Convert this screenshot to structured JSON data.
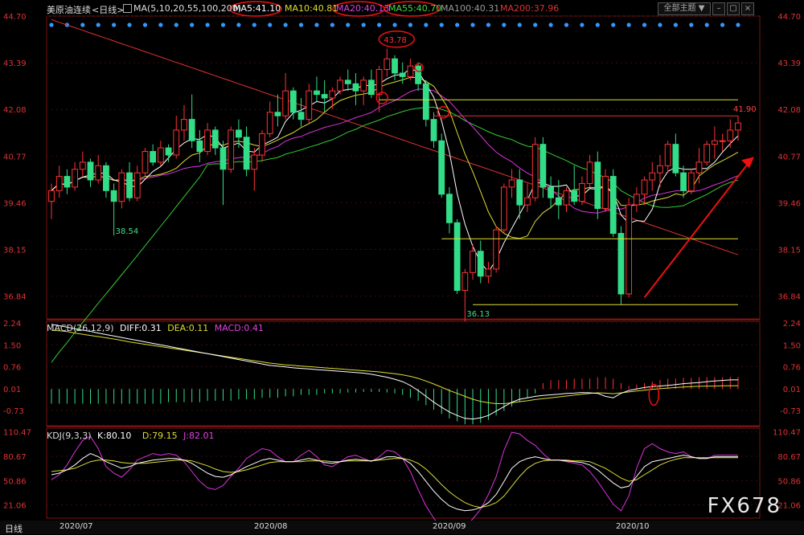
{
  "header": {
    "symbol": "美原油连续",
    "period": "<日线>",
    "ma_label": "MA(5,10,20,55,100,200)",
    "ma5": "MA5:41.10",
    "ma10": "MA10:40.81",
    "ma20": "MA20:40.13",
    "ma55": "MA55:40.70",
    "ma100": "MA100:40.31",
    "ma200": "MA200:37.96",
    "theme_button": "全部主题",
    "theme_arrow": "▼"
  },
  "macd": {
    "label": "MACD(26,12,9)",
    "diff": "DIFF:0.31",
    "dea": "DEA:0.11",
    "macd": "MACD:0.41"
  },
  "kdj": {
    "label": "KDJ(9,3,3)",
    "k": "K:80.10",
    "d": "D:79.15",
    "j": "J:82.01"
  },
  "footer": {
    "period": "日线",
    "dates": [
      "2020/07",
      "2020/08",
      "2020/09",
      "2020/10"
    ]
  },
  "watermark": "FX678",
  "colors": {
    "up": "#ff3333",
    "down": "#33dd88",
    "ma5": "#ffffff",
    "ma10": "#dddd33",
    "ma20": "#dd33dd",
    "ma55": "#33cc33",
    "ma100": "#999999",
    "ma200": "#dd3333",
    "dot": "#3399ff"
  },
  "chart_data": [
    {
      "type": "candlestick",
      "panel": "price",
      "ylim": [
        36.2,
        44.7
      ],
      "y_ticks": [
        "44.70",
        "43.39",
        "42.08",
        "40.77",
        "39.46",
        "38.15",
        "36.84"
      ],
      "annotations": [
        "43.78",
        "41.90",
        "38.54",
        "36.13"
      ],
      "candles": [
        [
          39.5,
          40.0,
          39.0,
          39.8
        ],
        [
          39.8,
          40.5,
          39.6,
          40.2
        ],
        [
          40.2,
          40.4,
          39.7,
          39.9
        ],
        [
          39.9,
          40.6,
          39.8,
          40.4
        ],
        [
          40.4,
          40.9,
          40.2,
          40.6
        ],
        [
          40.6,
          40.7,
          39.9,
          40.1
        ],
        [
          40.1,
          40.8,
          40.0,
          40.5
        ],
        [
          40.5,
          40.6,
          39.6,
          39.8
        ],
        [
          39.8,
          40.0,
          38.54,
          39.5
        ],
        [
          39.5,
          40.4,
          39.3,
          40.3
        ],
        [
          40.3,
          40.6,
          39.5,
          39.6
        ],
        [
          39.6,
          40.5,
          39.5,
          40.3
        ],
        [
          40.3,
          41.0,
          40.2,
          40.9
        ],
        [
          40.9,
          41.1,
          40.5,
          40.6
        ],
        [
          40.6,
          41.2,
          40.5,
          41.0
        ],
        [
          41.0,
          41.1,
          40.6,
          40.8
        ],
        [
          40.8,
          41.9,
          40.7,
          41.5
        ],
        [
          41.5,
          42.2,
          41.2,
          41.8
        ],
        [
          41.8,
          42.5,
          41.0,
          41.2
        ],
        [
          41.2,
          41.5,
          40.6,
          40.9
        ],
        [
          40.9,
          41.7,
          40.8,
          41.5
        ],
        [
          41.5,
          41.6,
          40.8,
          41.0
        ],
        [
          41.0,
          41.2,
          39.4,
          40.4
        ],
        [
          40.4,
          41.6,
          40.3,
          41.5
        ],
        [
          41.5,
          41.8,
          41.0,
          41.3
        ],
        [
          41.3,
          41.6,
          40.2,
          40.4
        ],
        [
          40.4,
          41.0,
          39.8,
          40.8
        ],
        [
          40.8,
          41.5,
          40.6,
          41.4
        ],
        [
          41.4,
          42.3,
          41.3,
          42.0
        ],
        [
          42.0,
          42.5,
          41.6,
          41.9
        ],
        [
          41.9,
          43.1,
          41.8,
          42.6
        ],
        [
          42.6,
          42.7,
          41.8,
          42.0
        ],
        [
          42.0,
          42.4,
          41.6,
          41.8
        ],
        [
          41.8,
          42.8,
          41.7,
          42.6
        ],
        [
          42.6,
          43.0,
          42.3,
          42.5
        ],
        [
          42.5,
          42.9,
          42.0,
          42.4
        ],
        [
          42.4,
          42.7,
          42.1,
          42.6
        ],
        [
          42.6,
          43.0,
          42.5,
          42.9
        ],
        [
          42.9,
          43.2,
          42.6,
          42.8
        ],
        [
          42.8,
          43.1,
          42.2,
          42.6
        ],
        [
          42.6,
          43.0,
          42.2,
          42.9
        ],
        [
          42.9,
          43.2,
          42.4,
          42.5
        ],
        [
          42.5,
          43.3,
          42.0,
          43.2
        ],
        [
          43.2,
          43.78,
          43.0,
          43.5
        ],
        [
          43.5,
          43.6,
          42.9,
          43.1
        ],
        [
          43.1,
          43.4,
          42.8,
          43.0
        ],
        [
          43.0,
          43.5,
          42.9,
          43.3
        ],
        [
          43.3,
          43.4,
          42.6,
          42.8
        ],
        [
          42.8,
          42.9,
          41.6,
          41.8
        ],
        [
          41.8,
          42.0,
          41.0,
          41.2
        ],
        [
          41.2,
          41.4,
          39.6,
          39.7
        ],
        [
          39.7,
          39.9,
          38.6,
          38.9
        ],
        [
          38.9,
          39.0,
          36.9,
          37.0
        ],
        [
          37.0,
          37.6,
          36.13,
          37.5
        ],
        [
          37.5,
          38.3,
          37.3,
          38.1
        ],
        [
          38.1,
          38.4,
          37.2,
          37.4
        ],
        [
          37.4,
          37.8,
          37.2,
          37.6
        ],
        [
          37.6,
          38.8,
          37.5,
          38.7
        ],
        [
          38.7,
          40.0,
          38.6,
          39.9
        ],
        [
          39.9,
          40.4,
          39.6,
          40.1
        ],
        [
          40.1,
          40.4,
          39.0,
          39.4
        ],
        [
          39.4,
          40.0,
          39.2,
          39.6
        ],
        [
          39.6,
          41.3,
          39.5,
          41.1
        ],
        [
          41.1,
          41.3,
          39.6,
          39.9
        ],
        [
          39.9,
          40.2,
          39.3,
          39.6
        ],
        [
          39.6,
          40.1,
          39.0,
          39.4
        ],
        [
          39.4,
          39.9,
          39.2,
          39.8
        ],
        [
          39.8,
          40.5,
          39.4,
          39.5
        ],
        [
          39.5,
          40.2,
          39.4,
          40.0
        ],
        [
          40.0,
          40.8,
          39.9,
          40.6
        ],
        [
          40.6,
          40.9,
          39.0,
          39.3
        ],
        [
          39.3,
          40.4,
          39.2,
          40.2
        ],
        [
          40.2,
          40.4,
          38.5,
          38.6
        ],
        [
          38.6,
          38.8,
          36.6,
          36.9
        ],
        [
          36.9,
          39.6,
          36.8,
          39.4
        ],
        [
          39.4,
          39.9,
          39.2,
          39.7
        ],
        [
          39.7,
          40.2,
          39.4,
          40.1
        ],
        [
          40.1,
          40.6,
          39.8,
          40.3
        ],
        [
          40.3,
          40.8,
          39.9,
          40.5
        ],
        [
          40.5,
          41.2,
          40.3,
          41.1
        ],
        [
          41.1,
          41.4,
          40.2,
          40.3
        ],
        [
          40.3,
          40.5,
          39.6,
          39.8
        ],
        [
          39.8,
          40.4,
          39.7,
          40.3
        ],
        [
          40.3,
          41.0,
          40.0,
          40.6
        ],
        [
          40.6,
          41.2,
          40.5,
          41.1
        ],
        [
          41.1,
          41.6,
          40.7,
          41.2
        ],
        [
          41.2,
          41.4,
          40.9,
          41.2
        ],
        [
          41.2,
          41.8,
          41.0,
          41.5
        ],
        [
          41.5,
          41.9,
          41.2,
          41.7
        ]
      ]
    },
    {
      "type": "macd",
      "panel": "macd",
      "ylim": [
        -1.25,
        2.3
      ],
      "y_ticks": [
        "2.24",
        "1.50",
        "0.76",
        "0.01",
        "-0.73"
      ],
      "diff": [
        2.2,
        2.15,
        2.1,
        2.05,
        2.0,
        1.96,
        1.9,
        1.85,
        1.8,
        1.75,
        1.7,
        1.65,
        1.6,
        1.55,
        1.5,
        1.45,
        1.4,
        1.35,
        1.3,
        1.25,
        1.2,
        1.15,
        1.1,
        1.05,
        1.0,
        0.95,
        0.9,
        0.85,
        0.8,
        0.78,
        0.75,
        0.72,
        0.7,
        0.68,
        0.66,
        0.64,
        0.62,
        0.6,
        0.58,
        0.56,
        0.54,
        0.5,
        0.45,
        0.4,
        0.33,
        0.25,
        0.12,
        -0.05,
        -0.25,
        -0.45,
        -0.62,
        -0.78,
        -0.9,
        -1.0,
        -1.02,
        -0.98,
        -0.9,
        -0.75,
        -0.6,
        -0.45,
        -0.35,
        -0.3,
        -0.25,
        -0.22,
        -0.2,
        -0.18,
        -0.15,
        -0.14,
        -0.12,
        -0.13,
        -0.15,
        -0.25,
        -0.3,
        -0.15,
        -0.05,
        0.0,
        0.05,
        0.08,
        0.1,
        0.12,
        0.15,
        0.18,
        0.2,
        0.22,
        0.25,
        0.27,
        0.29,
        0.31,
        0.31
      ],
      "dea": [
        2.0,
        1.98,
        1.95,
        1.9,
        1.86,
        1.82,
        1.78,
        1.74,
        1.7,
        1.65,
        1.6,
        1.56,
        1.52,
        1.48,
        1.44,
        1.4,
        1.36,
        1.32,
        1.28,
        1.24,
        1.2,
        1.16,
        1.12,
        1.08,
        1.04,
        1.0,
        0.96,
        0.92,
        0.88,
        0.85,
        0.82,
        0.8,
        0.78,
        0.76,
        0.74,
        0.72,
        0.7,
        0.68,
        0.66,
        0.64,
        0.62,
        0.6,
        0.58,
        0.55,
        0.52,
        0.48,
        0.43,
        0.36,
        0.27,
        0.17,
        0.06,
        -0.05,
        -0.15,
        -0.25,
        -0.35,
        -0.42,
        -0.47,
        -0.5,
        -0.5,
        -0.47,
        -0.43,
        -0.4,
        -0.36,
        -0.33,
        -0.3,
        -0.27,
        -0.24,
        -0.21,
        -0.18,
        -0.15,
        -0.13,
        -0.14,
        -0.16,
        -0.13,
        -0.1,
        -0.07,
        -0.04,
        -0.01,
        0.01,
        0.03,
        0.05,
        0.07,
        0.08,
        0.09,
        0.1,
        0.1,
        0.11,
        0.11,
        0.11
      ],
      "hist": [
        -0.5,
        -0.5,
        -0.5,
        -0.5,
        -0.5,
        -0.5,
        -0.5,
        -0.5,
        -0.5,
        -0.5,
        -0.5,
        -0.5,
        -0.5,
        -0.5,
        -0.5,
        -0.45,
        -0.45,
        -0.45,
        -0.45,
        -0.45,
        -0.4,
        -0.4,
        -0.4,
        -0.4,
        -0.35,
        -0.35,
        -0.35,
        -0.3,
        -0.3,
        -0.3,
        -0.25,
        -0.25,
        -0.2,
        -0.2,
        -0.2,
        -0.15,
        -0.15,
        -0.15,
        -0.12,
        -0.12,
        -0.1,
        -0.1,
        -0.1,
        -0.12,
        -0.15,
        -0.2,
        -0.3,
        -0.4,
        -0.55,
        -0.7,
        -0.85,
        -1.0,
        -1.1,
        -1.2,
        -1.2,
        -1.15,
        -1.05,
        -0.9,
        -0.75,
        -0.6,
        -0.45,
        -0.3,
        -0.15,
        0.2,
        0.3,
        0.3,
        0.3,
        0.35,
        0.35,
        0.35,
        0.4,
        0.4,
        0.35,
        0.2,
        0.1,
        0.15,
        0.2,
        0.25,
        0.3,
        0.35,
        0.35,
        0.38,
        0.38,
        0.4,
        0.4,
        0.4,
        0.4,
        0.41,
        0.41
      ]
    },
    {
      "type": "kdj",
      "panel": "kdj",
      "ylim": [
        5,
        115
      ],
      "y_ticks": [
        "110.47",
        "80.67",
        "50.86",
        "21.06"
      ],
      "k": [
        58,
        60,
        64,
        70,
        78,
        84,
        80,
        74,
        70,
        66,
        68,
        72,
        74,
        76,
        77,
        78,
        78,
        76,
        72,
        66,
        60,
        56,
        55,
        58,
        63,
        68,
        72,
        76,
        78,
        76,
        74,
        74,
        76,
        78,
        76,
        73,
        72,
        74,
        76,
        77,
        76,
        75,
        77,
        80,
        80,
        78,
        72,
        62,
        50,
        38,
        28,
        20,
        16,
        14,
        15,
        18,
        24,
        34,
        50,
        66,
        74,
        78,
        80,
        78,
        76,
        76,
        75,
        74,
        73,
        70,
        64,
        56,
        48,
        42,
        44,
        56,
        68,
        74,
        76,
        78,
        80,
        82,
        80,
        78,
        78,
        80,
        80,
        80,
        80
      ],
      "d": [
        62,
        63,
        64,
        66,
        70,
        74,
        76,
        76,
        75,
        73,
        72,
        72,
        72,
        73,
        74,
        75,
        76,
        76,
        75,
        72,
        69,
        65,
        62,
        61,
        62,
        64,
        67,
        70,
        73,
        74,
        74,
        74,
        74,
        75,
        75,
        75,
        74,
        74,
        75,
        75,
        75,
        75,
        76,
        77,
        78,
        78,
        76,
        72,
        65,
        56,
        46,
        37,
        30,
        24,
        20,
        18,
        20,
        24,
        32,
        44,
        56,
        66,
        72,
        75,
        76,
        76,
        76,
        75,
        75,
        74,
        70,
        66,
        60,
        54,
        50,
        52,
        58,
        64,
        70,
        74,
        77,
        79,
        79,
        79,
        79,
        79,
        79,
        79,
        79
      ],
      "j": [
        52,
        58,
        70,
        86,
        100,
        105,
        90,
        68,
        60,
        55,
        64,
        76,
        80,
        84,
        82,
        84,
        82,
        74,
        62,
        50,
        42,
        40,
        45,
        56,
        66,
        78,
        84,
        90,
        88,
        80,
        74,
        74,
        82,
        88,
        80,
        70,
        68,
        74,
        80,
        82,
        78,
        74,
        80,
        88,
        86,
        78,
        62,
        40,
        20,
        5,
        -8,
        -14,
        -12,
        -6,
        4,
        16,
        34,
        56,
        88,
        110,
        108,
        100,
        94,
        84,
        76,
        76,
        74,
        72,
        70,
        62,
        50,
        36,
        22,
        14,
        32,
        66,
        90,
        96,
        90,
        86,
        84,
        86,
        80,
        78,
        78,
        82,
        82,
        82,
        82
      ]
    }
  ]
}
